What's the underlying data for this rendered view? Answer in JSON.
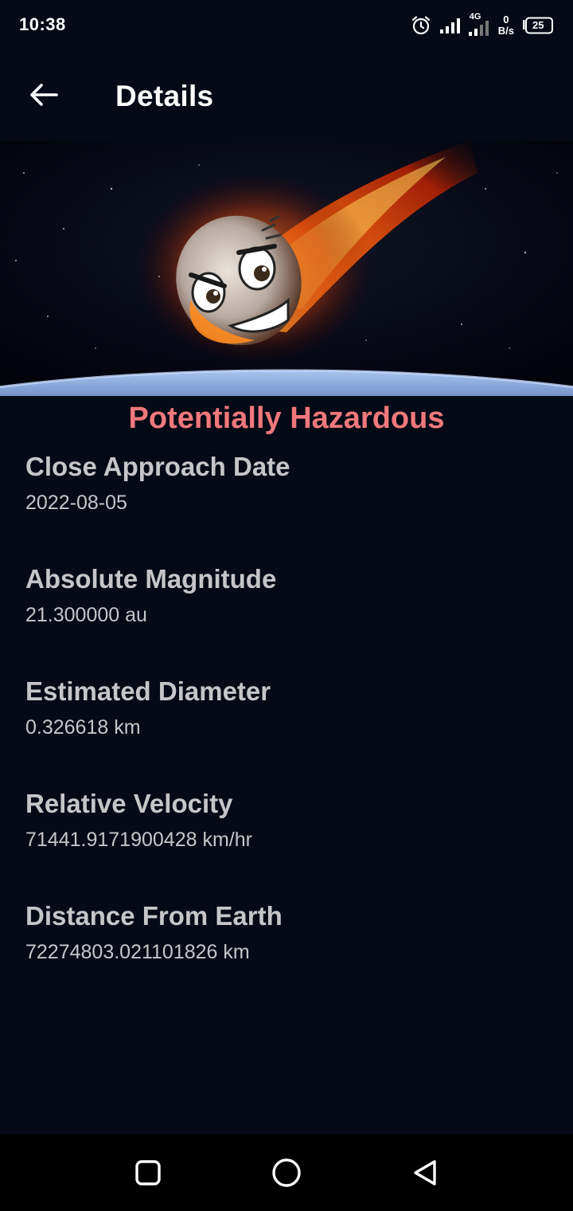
{
  "status_bar": {
    "time": "10:38",
    "network_type": "4G",
    "net_speed_value": "0",
    "net_speed_unit": "B/s",
    "battery": "25",
    "icons": [
      "alarm-icon",
      "signal-icon",
      "signal-4g-icon",
      "battery-icon"
    ]
  },
  "app_bar": {
    "title": "Details",
    "back_icon": "arrow-left-icon"
  },
  "hero": {
    "image": "flaming-asteroid-over-earth"
  },
  "hazard_label": "Potentially Hazardous",
  "details": [
    {
      "label": "Close Approach Date",
      "value": "2022-08-05"
    },
    {
      "label": "Absolute Magnitude",
      "value": "21.300000 au"
    },
    {
      "label": "Estimated Diameter",
      "value": "0.326618 km"
    },
    {
      "label": "Relative Velocity",
      "value": "71441.9171900428 km/hr"
    },
    {
      "label": "Distance From Earth",
      "value": "72274803.021101826 km"
    }
  ],
  "nav_bar": {
    "icons": [
      "recents-square-icon",
      "home-circle-icon",
      "back-triangle-icon"
    ]
  },
  "colors": {
    "background": "#050a16",
    "hazard_text": "#f0787b",
    "detail_text": "#c6c6c8"
  }
}
